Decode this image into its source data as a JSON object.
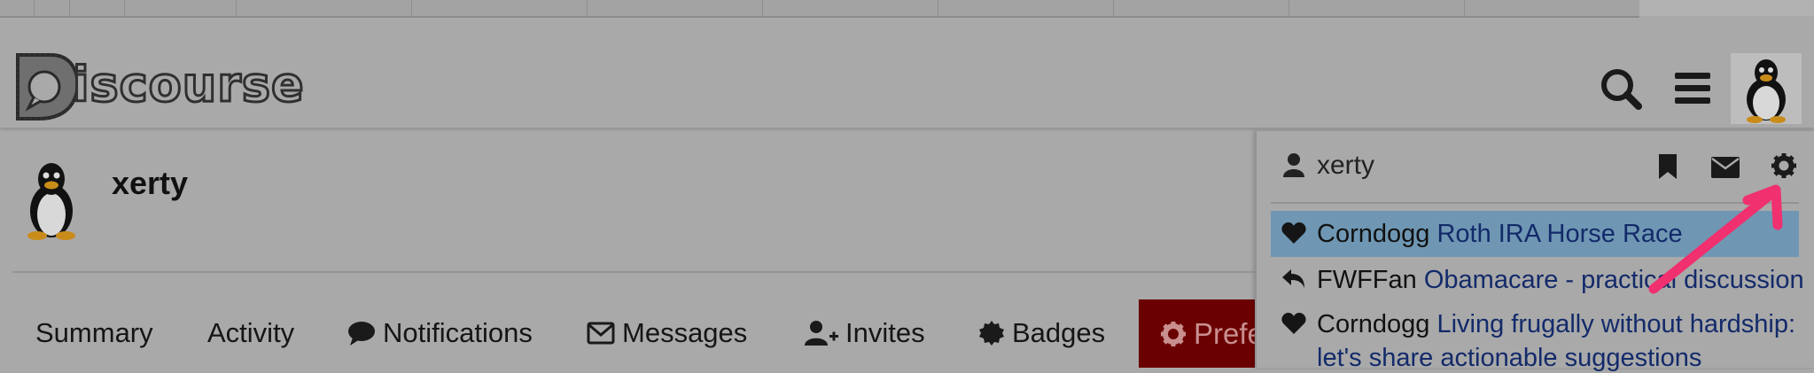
{
  "header": {
    "logo_text": "iscourse",
    "icons": [
      "search-icon",
      "hamburger-menu-icon",
      "user-avatar"
    ]
  },
  "profile": {
    "username": "xerty"
  },
  "nav": {
    "tabs": [
      {
        "label": "Summary"
      },
      {
        "label": "Activity"
      },
      {
        "label": "Notifications"
      },
      {
        "label": "Messages"
      },
      {
        "label": "Invites"
      },
      {
        "label": "Badges"
      },
      {
        "label": "Prefe"
      }
    ]
  },
  "panel": {
    "username": "xerty",
    "notifications": [
      {
        "icon": "heart-icon",
        "user": "Corndogg",
        "topic": "Roth IRA Horse Race",
        "highlighted": true
      },
      {
        "icon": "reply-icon",
        "user": "FWFFan",
        "topic": "Obamacare - practical discussion"
      },
      {
        "icon": "heart-icon",
        "user": "Corndogg",
        "topic": "Living frugally without hardship:",
        "topic_line2": "let's share actionable suggestions"
      }
    ]
  },
  "colors": {
    "overlay_gray": "#a9a9a9",
    "preferences_tab": "#6b0000",
    "highlight_row": "#6f97b3",
    "annotation_arrow": "#f0306f",
    "link_text": "#132a6a"
  }
}
